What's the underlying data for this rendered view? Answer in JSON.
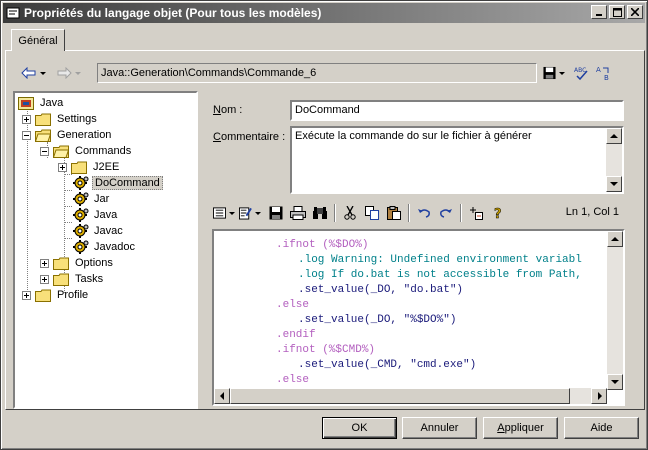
{
  "window": {
    "title": "Propriétés du langage objet (Pour tous les modèles)",
    "controls": [
      "_",
      "□",
      "×"
    ]
  },
  "tabs": [
    {
      "label": "Général",
      "active": true
    }
  ],
  "toolbar": {
    "path": "Java::Generation\\Commands\\Commande_6"
  },
  "tree": {
    "items": [
      {
        "label": "Java",
        "icon": "language-icon"
      },
      {
        "label": "Settings",
        "icon": "folder-icon"
      },
      {
        "label": "Generation",
        "icon": "folder-open-icon"
      },
      {
        "label": "Commands",
        "icon": "folder-open-icon"
      },
      {
        "label": "J2EE",
        "icon": "folder-icon"
      },
      {
        "label": "DoCommand",
        "icon": "gear-icon",
        "selected": true
      },
      {
        "label": "Jar",
        "icon": "gear-icon"
      },
      {
        "label": "Java",
        "icon": "gear-icon"
      },
      {
        "label": "Javac",
        "icon": "gear-icon"
      },
      {
        "label": "Javadoc",
        "icon": "gear-icon"
      },
      {
        "label": "Options",
        "icon": "folder-icon"
      },
      {
        "label": "Tasks",
        "icon": "folder-icon"
      },
      {
        "label": "Profile",
        "icon": "folder-icon"
      }
    ]
  },
  "form": {
    "name_label_underlined": "N",
    "name_label_rest": "om :",
    "name_value": "DoCommand",
    "comment_label_underlined": "C",
    "comment_label_rest": "ommentaire :",
    "comment_value": "Exécute la commande do sur le fichier à générer"
  },
  "editor": {
    "position": "Ln 1, Col 1",
    "lines": [
      {
        "text": ".ifnot (%$DO%)",
        "kind": "kw"
      },
      {
        "text": ".log Warning: Undefined environment variabl",
        "kind": "cm"
      },
      {
        "text": ".log If do.bat is not accessible from Path,",
        "kind": "cm"
      },
      {
        "text": ".set_value(_DO, \"do.bat\")",
        "kind": "tx"
      },
      {
        "text": ".else",
        "kind": "kw"
      },
      {
        "text": ".set_value(_DO, \"%$DO%\")",
        "kind": "tx"
      },
      {
        "text": ".endif",
        "kind": "kw"
      },
      {
        "text": ".ifnot (%$CMD%)",
        "kind": "kw"
      },
      {
        "text": ".set_value(_CMD, \"cmd.exe\")",
        "kind": "tx"
      },
      {
        "text": ".else",
        "kind": "kw"
      }
    ]
  },
  "buttons": {
    "ok": "OK",
    "cancel": "Annuler",
    "apply_underlined": "A",
    "apply_rest": "ppliquer",
    "help": "Aide"
  },
  "colors": {
    "keyword": "#b35fbf",
    "comment": "#00808a",
    "text": "#1a1a7a",
    "titlebar_start": "#3b3b3b",
    "titlebar_end": "#a8a8a8"
  }
}
